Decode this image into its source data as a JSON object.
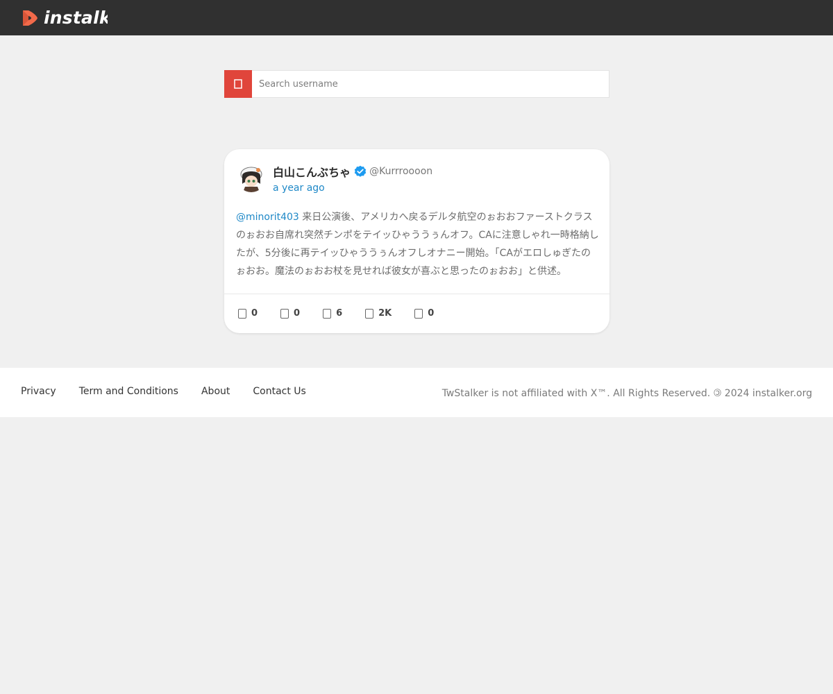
{
  "header": {
    "logo_text": "instalker"
  },
  "search": {
    "placeholder": "Search username",
    "value": ""
  },
  "tweet": {
    "author_name": "白山こんぶちゃ",
    "author_handle": "@Kurrroooon",
    "verified": true,
    "time": "a year ago",
    "mention": "@minorit403",
    "text": " 来日公演後、アメリカへ戻るデルタ航空のぉおおファーストクラスのぉおお自席れ突然チンポをテイッひゃううぅんオフ。CAに注意しゃれ一時格納したが、5分後に再テイッひゃううぅんオフしオナニー開始。「CAがエロしゅぎたのぉおお。魔法のぉおお杖を見せれば彼女が喜ぶと思ったのぉおお」と供述。",
    "stats": {
      "replies": "0",
      "retweets": "0",
      "quotes": "6",
      "likes": "2K",
      "bookmarks": "0"
    }
  },
  "footer": {
    "links": [
      "Privacy",
      "Term and Conditions",
      "About",
      "Contact Us"
    ],
    "copyright": "TwStalker is not affiliated with X™. All Rights Reserved. 🄯 2024 instalker.org"
  },
  "colors": {
    "topbar": "#303030",
    "accent": "#e0453b",
    "link": "#1e88c7",
    "logo_mark": "#f26a4a",
    "verified": "#1d9bf0"
  }
}
